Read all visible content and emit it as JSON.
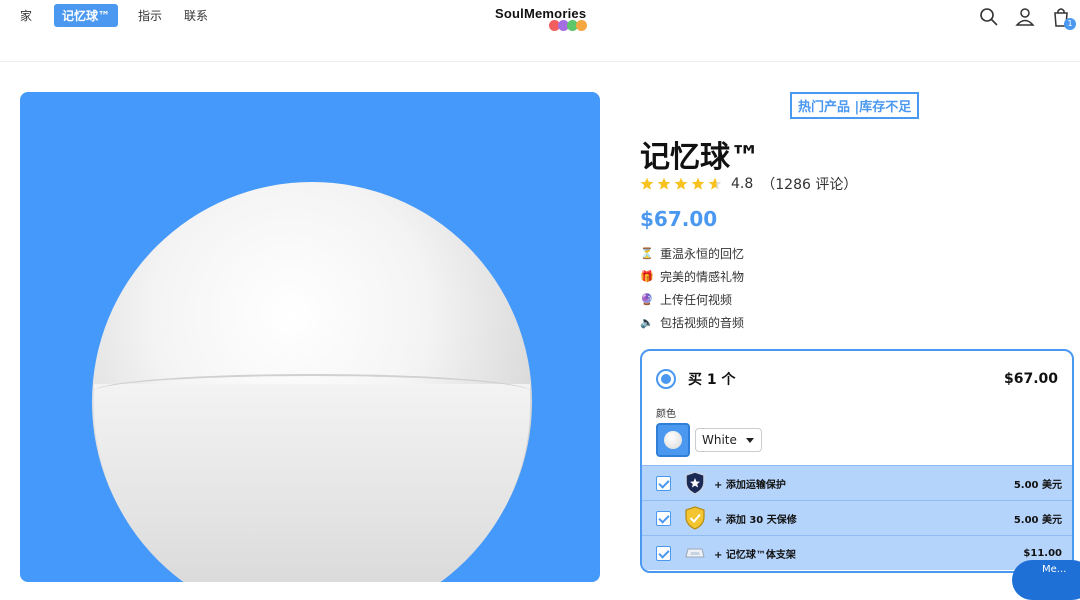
{
  "nav": {
    "items": [
      {
        "label": "家",
        "active": false
      },
      {
        "label": "记忆球™",
        "active": true
      },
      {
        "label": "指示",
        "active": false
      },
      {
        "label": "联系",
        "active": false
      }
    ]
  },
  "logo": {
    "text": "SoulMemories"
  },
  "header_icons": [
    "search-icon",
    "user-icon",
    "cart-icon"
  ],
  "cart": {
    "count": "1"
  },
  "product": {
    "badge": "热门产品 |库存不足",
    "title": "记忆球™",
    "rating": "4.8",
    "reviews": "（1286 评论）",
    "price": "$67.00",
    "features": [
      {
        "icon": "hourglass-icon",
        "text": "重温永恒的回忆"
      },
      {
        "icon": "gift-icon",
        "text": "完美的情感礼物"
      },
      {
        "icon": "crystal-ball-icon",
        "text": "上传任何视频"
      },
      {
        "icon": "speaker-icon",
        "text": "包括视频的音频"
      }
    ]
  },
  "offer": {
    "label": "买 1 个",
    "price": "$67.00",
    "color_label": "颜色",
    "selected_color": "White",
    "addons": [
      {
        "label": "+ 添加运输保护",
        "price": "5.00 美元"
      },
      {
        "label": "+ 添加 30 天保修",
        "price": "5.00 美元"
      },
      {
        "label": "+ 记忆球™体支架",
        "price": "$11.00"
      }
    ]
  },
  "chat": {
    "label": "Me..."
  },
  "colors": {
    "accent": "#4a98f0",
    "hero_bg": "#4499fa",
    "addon_bg": "#b5d4fb"
  }
}
